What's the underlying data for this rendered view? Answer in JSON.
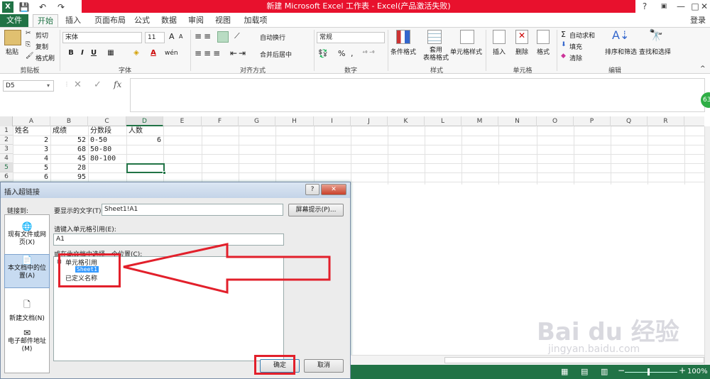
{
  "window": {
    "title": "新建 Microsoft Excel 工作表 - Excel(产品激活失败)",
    "help": "?",
    "minimize": "—",
    "restore": "□",
    "close": "✕",
    "login": "登录"
  },
  "qat": {
    "save": "💾",
    "undo": "↶",
    "redo": "↷"
  },
  "tabs": [
    "文件",
    "开始",
    "插入",
    "页面布局",
    "公式",
    "数据",
    "审阅",
    "视图",
    "加载项"
  ],
  "ribbon": {
    "clipboard": {
      "paste": "粘贴",
      "cut": "剪切",
      "copy": "复制",
      "format_painter": "格式刷",
      "label": "剪贴板"
    },
    "font": {
      "name": "宋体",
      "size": "11",
      "label": "字体",
      "bold": "B",
      "italic": "I",
      "underline": "U",
      "grow": "A",
      "shrink": "A",
      "font_color": "A",
      "fill": "◈"
    },
    "alignment": {
      "wrap": "自动换行",
      "merge": "合并后居中",
      "label": "对齐方式"
    },
    "number": {
      "format": "常规",
      "percent": "%",
      "comma": ",",
      "label": "数字"
    },
    "styles": {
      "conditional": "条件格式",
      "table": "套用\n表格格式",
      "cell": "单元格样式",
      "label": "样式"
    },
    "cells": {
      "insert": "插入",
      "delete": "删除",
      "format": "格式",
      "label": "单元格"
    },
    "editing": {
      "autosum": "自动求和",
      "fill": "填充",
      "clear": "清除",
      "sort": "排序和筛选",
      "find": "查找和选择",
      "label": "编辑"
    }
  },
  "formula_bar": {
    "name_box": "D5",
    "cancel": "✕",
    "enter": "✓",
    "fx": "fx",
    "value": ""
  },
  "grid": {
    "columns": [
      "A",
      "B",
      "C",
      "D",
      "E",
      "F",
      "G",
      "H",
      "I",
      "J",
      "K",
      "L",
      "M",
      "N",
      "O",
      "P",
      "Q",
      "R"
    ],
    "rows": [
      "1",
      "2",
      "3",
      "4",
      "5",
      "6"
    ],
    "cells": [
      [
        "姓名",
        "成绩",
        "分数段",
        "人数"
      ],
      [
        "2",
        "52",
        "0-50",
        "6"
      ],
      [
        "3",
        "68",
        "50-80",
        ""
      ],
      [
        "4",
        "45",
        "80-100",
        ""
      ],
      [
        "5",
        "28",
        "",
        ""
      ],
      [
        "6",
        "95",
        "",
        ""
      ]
    ]
  },
  "dialog": {
    "title": "插入超链接",
    "link_to_label": "链接到:",
    "sidebar": [
      {
        "label": "现有文件或网\n页(X)"
      },
      {
        "label": "本文档中的位\n置(A)"
      },
      {
        "label": "新建文档(N)"
      },
      {
        "label": "电子邮件地址\n(M)"
      }
    ],
    "display_text_label": "要显示的文字(T):",
    "display_text_value": "Sheet1!A1",
    "screen_tip": "屏幕提示(P)...",
    "cell_ref_label": "请键入单元格引用(E):",
    "cell_ref_value": "A1",
    "place_label": "或在此文档中选择一个位置(C):",
    "tree": {
      "node1": "单元格引用",
      "child1": "Sheet1",
      "node2": "已定义名称"
    },
    "ok": "确定",
    "cancel": "取消",
    "help": "?",
    "close": "✕"
  },
  "status": {
    "zoom": "100%",
    "minus": "−",
    "plus": "+"
  },
  "side_badge": "63",
  "watermark": {
    "brand": "Bai du 经验",
    "url": "jingyan.baidu.com"
  }
}
